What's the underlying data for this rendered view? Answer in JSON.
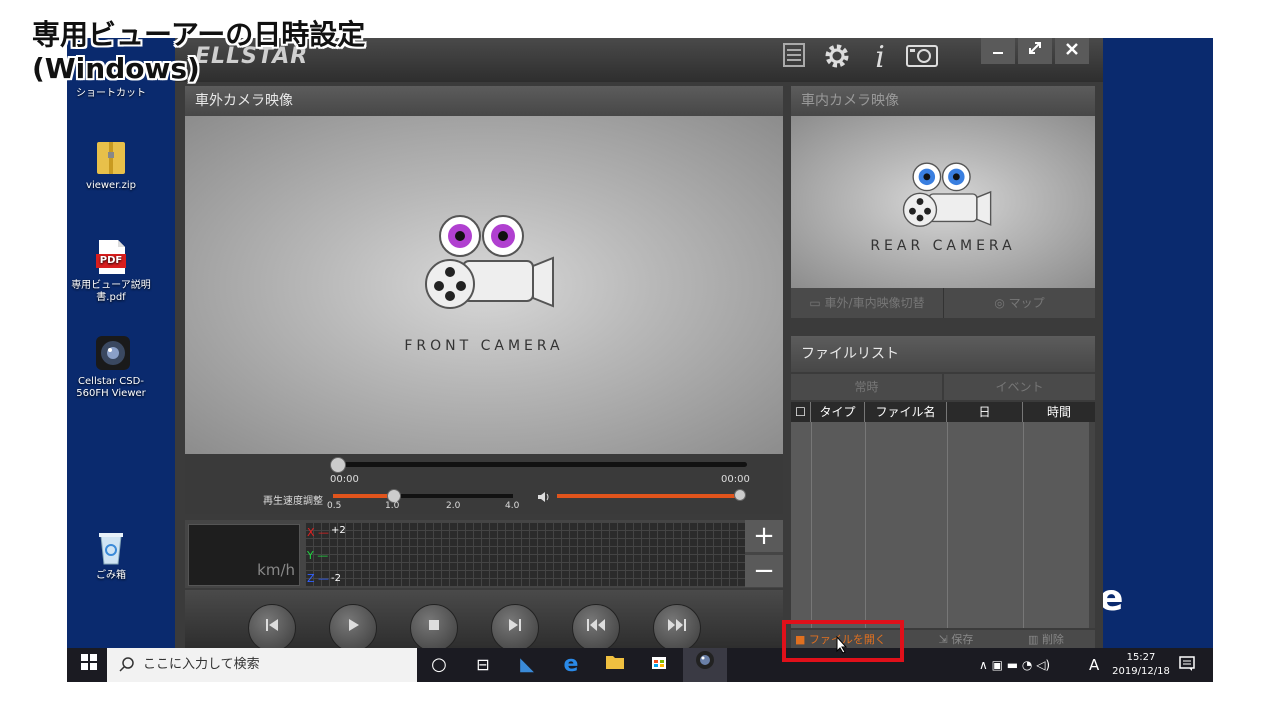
{
  "caption": {
    "line1": "専用ビューアーの日時設定",
    "line2": "(Windows)"
  },
  "desktop": {
    "icons": [
      {
        "label": "ショートカット"
      },
      {
        "label": "viewer.zip"
      },
      {
        "label": "専用ビューア説明書.pdf",
        "badge": "PDF"
      },
      {
        "label": "Cellstar CSD-560FH Viewer"
      },
      {
        "label": "ごみ箱"
      }
    ],
    "bg_text": "e"
  },
  "app": {
    "logo": "ELLSTAR",
    "front_panel": {
      "title": "車外カメラ映像",
      "label": "FRONT CAMERA"
    },
    "rear_panel": {
      "title": "車内カメラ映像",
      "label": "REAR CAMERA",
      "switch_btn": "車外/車内映像切替",
      "map_btn": "マップ"
    },
    "playback": {
      "time_start": "00:00",
      "time_end": "00:00",
      "speed_label": "再生速度調整",
      "speed_ticks": [
        "0.5",
        "1.0",
        "2.0",
        "4.0"
      ],
      "speed_value": 1.0,
      "seek_progress": 0.0,
      "volume_level": 1.0
    },
    "sensor": {
      "speed_unit": "km/h",
      "x_label": "X",
      "y_label": "Y",
      "z_label": "Z",
      "plus2": "+2",
      "minus2": "-2",
      "plus_btn": "+",
      "minus_btn": "−"
    },
    "file_list": {
      "title": "ファイルリスト",
      "tabs": [
        "常時",
        "イベント"
      ],
      "columns": [
        "タイプ",
        "ファイル名",
        "日",
        "時間"
      ],
      "open_btn": "ファイルを開く",
      "save_btn": "保存",
      "delete_btn": "削除"
    }
  },
  "taskbar": {
    "search_placeholder": "ここに入力して検索",
    "ime": "A",
    "time": "15:27",
    "date": "2019/12/18"
  },
  "colors": {
    "accent_orange": "#e0541c",
    "highlight_red": "#e0101a",
    "front_eye": "#b040d0",
    "rear_eye": "#3a7fe0"
  }
}
